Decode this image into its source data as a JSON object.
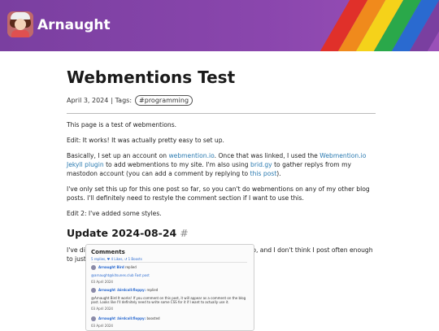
{
  "site": {
    "title": "Arnaught"
  },
  "post": {
    "title": "Webmentions Test",
    "date": "April 3, 2024",
    "tags_label": "| Tags:",
    "tag": "#programming",
    "p1": "This page is a test of webmentions.",
    "p2": "Edit: It works! It was actually pretty easy to set up.",
    "p3_a": "Basically, I set up an account on ",
    "p3_link1": "webmention.io",
    "p3_b": ". Once that was linked, I used the ",
    "p3_link2": "Webmention.io Jekyll plugin",
    "p3_c": " to add webmentions to my site. I'm also using ",
    "p3_link3": "brid.gy",
    "p3_d": " to gather replys from my mastodon account (you can add a comment by replying to ",
    "p3_link4": "this post",
    "p3_e": ").",
    "p4": "I've only set this up for this one post so far, so you can't do webmentions on any of my other blog posts. I'll definitely need to restyle the comment section if I want to use this.",
    "p5": "Edit 2: I've added some styles.",
    "h2": "Update 2024-08-24",
    "h2_hash": "#",
    "p6": "I've disabled webmentions. It was a little messy to get set up, and I don't think I post often enough to justify it. Here's what it looked like when it was live:"
  },
  "comments_shot": {
    "title": "Comments",
    "stats": "5 replies, ♥ 4 Likes, ↺ 1 Boosts",
    "entries": [
      {
        "name": "Arnaught Bird",
        "action": "replied",
        "text": "@arnaught@kitsunes.club Fast post",
        "date": "03 April 2024"
      },
      {
        "name": "Arnaught :birdcall:floppy:",
        "action": "replied",
        "text": "@Arnaught Bird It works! If you comment on this post, it will appear as a comment on the blog post. Looks like I'll definitely need to write some CSS for it if I want to actually use it.",
        "date": "03 April 2024"
      },
      {
        "name": "Arnaught :birdcall:floppy:",
        "action": "boosted",
        "text": "",
        "date": "03 April 2024"
      }
    ]
  },
  "colors": {
    "header": "#8a46ad",
    "link": "#2a7ab0",
    "rainbow": [
      "#e0302a",
      "#f08a1c",
      "#f5d21a",
      "#2aa84a",
      "#2a6ad0",
      "#7a3fa0"
    ]
  }
}
